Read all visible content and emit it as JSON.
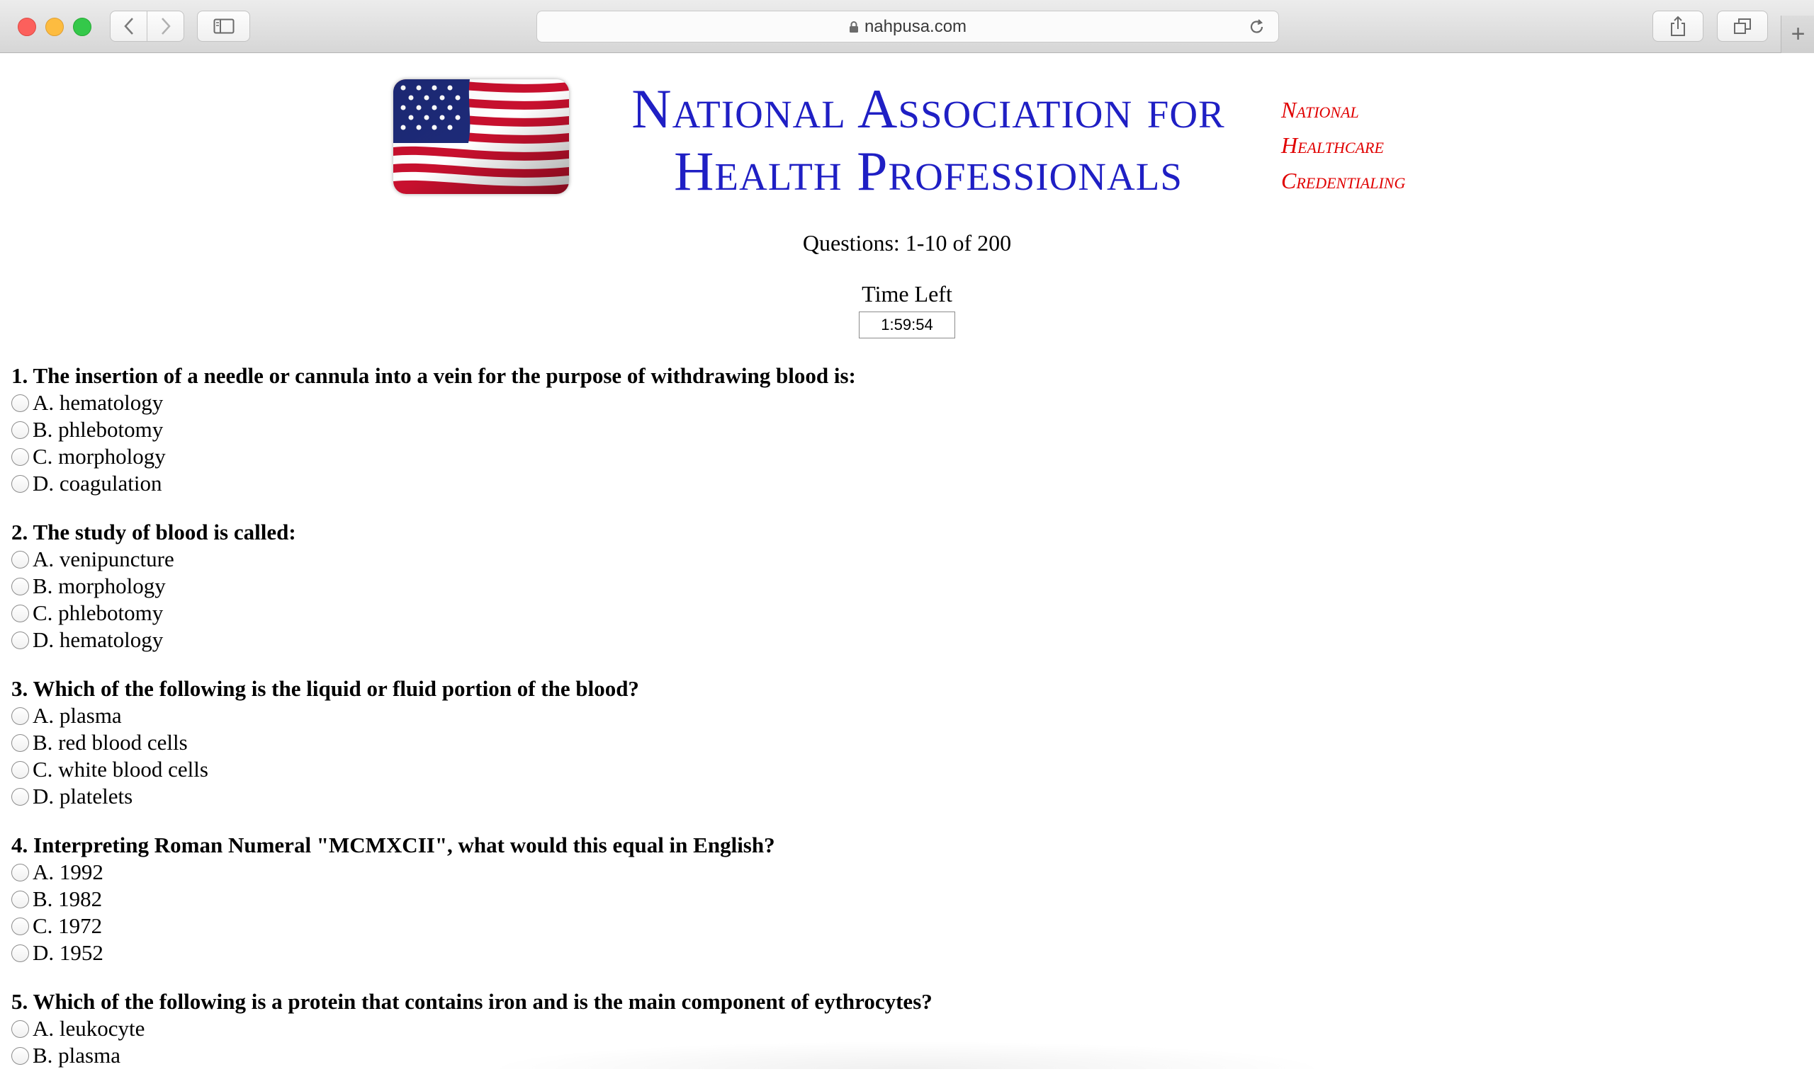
{
  "browser": {
    "url": "nahpusa.com",
    "new_tab_label": "+"
  },
  "header": {
    "org_line1": "National Association for",
    "org_line2": "Health Professionals",
    "cred_line1": "National",
    "cred_line2": "Healthcare",
    "cred_line3": "Credentialing"
  },
  "quiz": {
    "question_range": "Questions: 1-10 of 200",
    "time_left_label": "Time Left",
    "time_left_value": "1:59:54",
    "questions": [
      {
        "text": "1. The insertion of a needle or cannula into a vein for the purpose of withdrawing blood is:",
        "options": [
          "A. hematology",
          "B. phlebotomy",
          "C. morphology",
          "D. coagulation"
        ]
      },
      {
        "text": "2. The study of blood is called:",
        "options": [
          "A. venipuncture",
          "B. morphology",
          "C. phlebotomy",
          "D. hematology"
        ]
      },
      {
        "text": "3. Which of the following is the liquid or fluid portion of the blood?",
        "options": [
          "A. plasma",
          "B. red blood cells",
          "C. white blood cells",
          "D. platelets"
        ]
      },
      {
        "text": "4. Interpreting Roman Numeral \"MCMXCII\", what would this equal in English?",
        "options": [
          "A. 1992",
          "B. 1982",
          "C. 1972",
          "D. 1952"
        ]
      },
      {
        "text": "5. Which of the following is a protein that contains iron and is the main component of eythrocytes?",
        "options": [
          "A. leukocyte",
          "B. plasma"
        ]
      }
    ]
  },
  "colors": {
    "org_blue": "#1f1fc4",
    "cred_red": "#e00000"
  }
}
